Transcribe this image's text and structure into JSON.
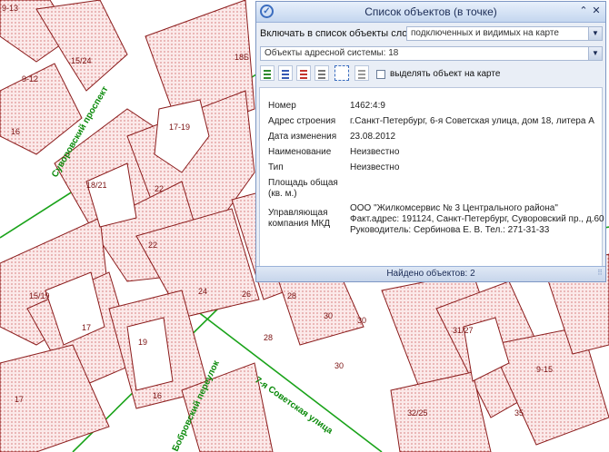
{
  "map": {
    "parcel_labels": [
      "9-13",
      "15/24",
      "9-12",
      "16",
      "18Б",
      "17-19",
      "18/21",
      "22",
      "22",
      "24",
      "26",
      "28",
      "30",
      "30",
      "15/19",
      "17",
      "19",
      "16",
      "17",
      "28",
      "30",
      "31/27",
      "32/25",
      "35",
      "9-15"
    ],
    "street_labels": {
      "suvorovsky": "Суворовский проспект",
      "sovetskaya": "7-я Советская улица",
      "sovetskaya_short": "7-я Советская улица",
      "kirochny": "Бобровский переулок"
    }
  },
  "panel": {
    "title": "Список объектов (в точке)",
    "title_pin_icon": "pin-icon",
    "include_label": "Включать в список объекты слоев:",
    "include_value": "подключенных и видимых на карте",
    "layer_value": "Объекты адресной системы: 18",
    "highlight_label": "выделять объект на карте",
    "fields": [
      {
        "label": "Номер",
        "value": "1462:4:9"
      },
      {
        "label": "Адрес строения",
        "value": "г.Санкт-Петербург, 6-я Советская улица, дом 18, литера А"
      },
      {
        "label": "Дата изменения",
        "value": "23.08.2012"
      },
      {
        "label": "Наименование",
        "value": "Неизвестно"
      },
      {
        "label": "Тип",
        "value": "Неизвестно"
      },
      {
        "label": "Площадь общая (кв. м.)",
        "value": ""
      },
      {
        "label": "Управляющая компания МКД",
        "value": "ООО \"Жилкомсервис № 3 Центрального района\" Факт.адрес: 191124, Санкт-Петербург, Суворовский пр., д.60 Руководитель: Сербинова Е. В. Тел.: 271-31-33"
      }
    ],
    "status": "Найдено объектов: 2"
  }
}
